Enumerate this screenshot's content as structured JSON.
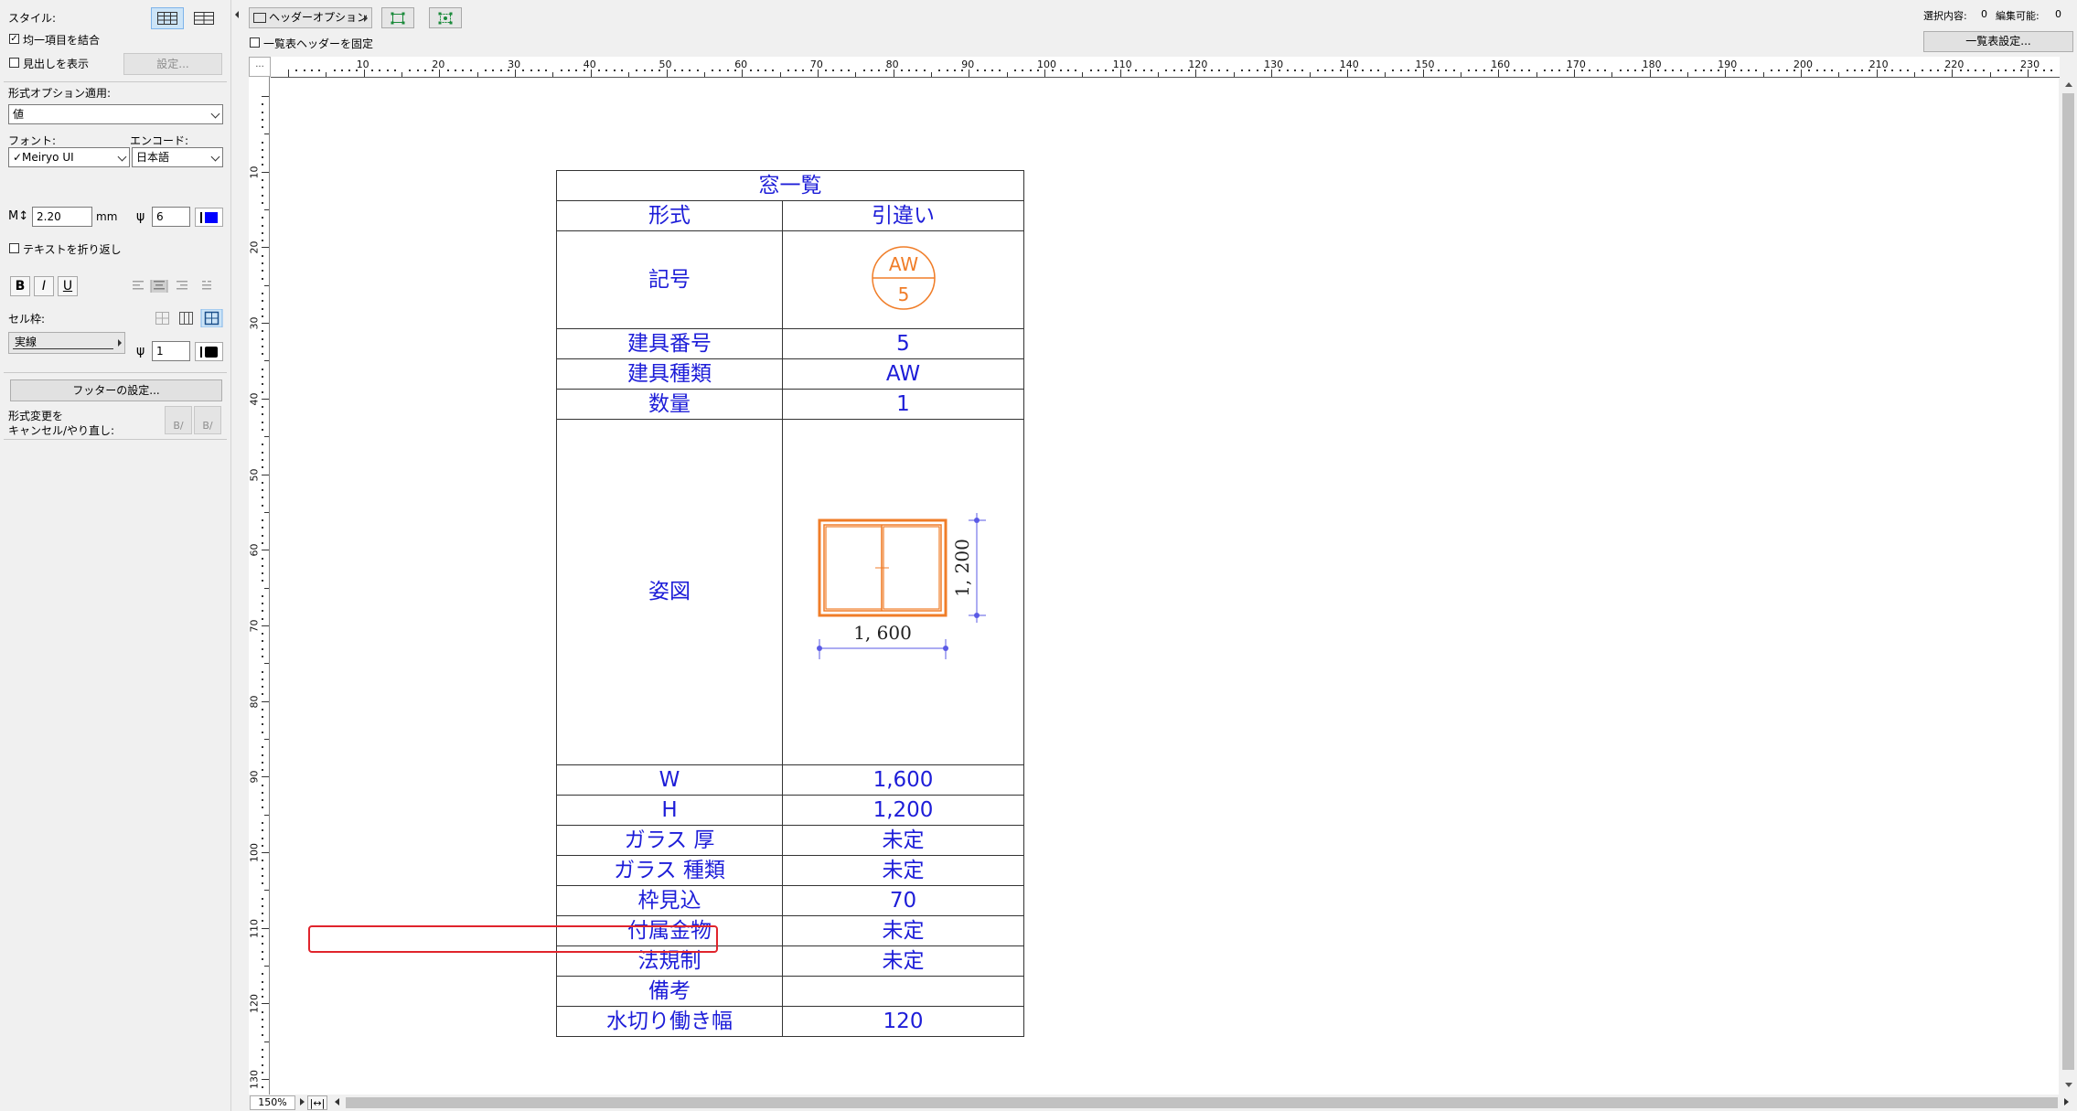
{
  "left": {
    "style_label": "スタイル:",
    "merge_uniform_label": "均一項目を結合",
    "merge_uniform_checked": true,
    "show_header_label": "見出しを表示",
    "show_header_checked": false,
    "settings_button": "設定...",
    "format_apply_label": "形式オプション適用:",
    "format_apply_value": "値",
    "font_label": "フォント:",
    "font_value": "✓Meiryo UI",
    "encoding_label": "エンコード:",
    "encoding_value": "日本語",
    "font_size_value": "2.20",
    "font_size_unit": "mm",
    "pen_value": "6",
    "text_color": "#0000ff",
    "wrap_text_label": "テキストを折り返し",
    "wrap_text_checked": false,
    "bold_label": "B",
    "italic_label": "I",
    "underline_label": "U",
    "cell_frame_label": "セル枠:",
    "line_type_value": "実線",
    "frame_pen_value": "1",
    "frame_color": "#000000",
    "footer_button": "フッターの設定...",
    "undo_label_1": "形式変更を",
    "undo_label_2": "キャンセル/やり直し:",
    "undo_btn": "B/",
    "redo_btn": "B/"
  },
  "toolbar": {
    "header_options": "ヘッダーオプション",
    "fix_header_label": "一覧表ヘッダーを固定",
    "fix_header_checked": false,
    "selection_label": "選択内容:",
    "selection_count": "0",
    "editable_label": "編集可能:",
    "editable_count": "0",
    "schedule_settings": "一覧表設定..."
  },
  "ruler": {
    "corner": "...",
    "h_labels": [
      "10",
      "20",
      "30",
      "40",
      "50",
      "60",
      "70",
      "80",
      "90",
      "100",
      "110",
      "120",
      "130",
      "140",
      "150",
      "160",
      "170",
      "180",
      "190",
      "200",
      "210",
      "220",
      "230"
    ],
    "v_labels": [
      "10",
      "20",
      "30",
      "40",
      "50",
      "60",
      "70",
      "80",
      "90",
      "100",
      "110",
      "120",
      "130"
    ]
  },
  "schedule": {
    "title": "窓一覧",
    "rows": [
      {
        "label": "形式",
        "value": "引違い"
      },
      {
        "label": "記号",
        "value": ""
      },
      {
        "label": "建具番号",
        "value": "5"
      },
      {
        "label": "建具種類",
        "value": "AW"
      },
      {
        "label": "数量",
        "value": "1"
      },
      {
        "label": "姿図",
        "value": ""
      },
      {
        "label": "W",
        "value": "1,600"
      },
      {
        "label": "H",
        "value": "1,200"
      },
      {
        "label": "ガラス 厚",
        "value": "未定"
      },
      {
        "label": "ガラス 種類",
        "value": "未定"
      },
      {
        "label": "枠見込",
        "value": "70"
      },
      {
        "label": "付属金物",
        "value": "未定"
      },
      {
        "label": "法規制",
        "value": "未定"
      },
      {
        "label": "備考",
        "value": ""
      },
      {
        "label": "水切り働き幅",
        "value": "120"
      }
    ],
    "symbol_top": "AW",
    "symbol_bottom": "5",
    "dim_width": "1, 600",
    "dim_height": "1, 200"
  },
  "statusbar": {
    "zoom": "150%"
  },
  "colors": {
    "text_blue": "#1d1dd8",
    "symbol_orange": "#f07d28",
    "highlight_red": "#e0242c",
    "dim_blue": "#5a5ae6"
  }
}
